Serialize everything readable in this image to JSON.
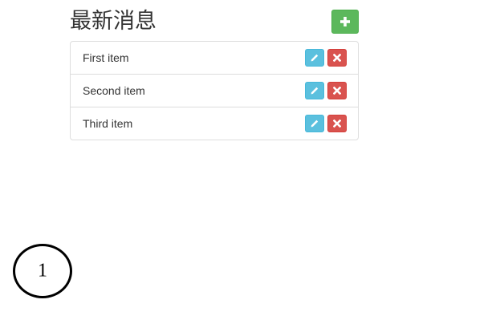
{
  "header": {
    "title": "最新消息"
  },
  "toolbar": {
    "add_icon": "plus-icon"
  },
  "list": {
    "items": [
      {
        "label": "First item",
        "edit_icon": "pencil-icon",
        "delete_icon": "times-icon"
      },
      {
        "label": "Second item",
        "edit_icon": "pencil-icon",
        "delete_icon": "times-icon"
      },
      {
        "label": "Third item",
        "edit_icon": "pencil-icon",
        "delete_icon": "times-icon"
      }
    ]
  },
  "page_indicator": {
    "number": "1"
  },
  "colors": {
    "add": "#5cb85c",
    "edit": "#5bc0de",
    "delete": "#d9534f",
    "border": "#dddddd",
    "text": "#333333"
  }
}
